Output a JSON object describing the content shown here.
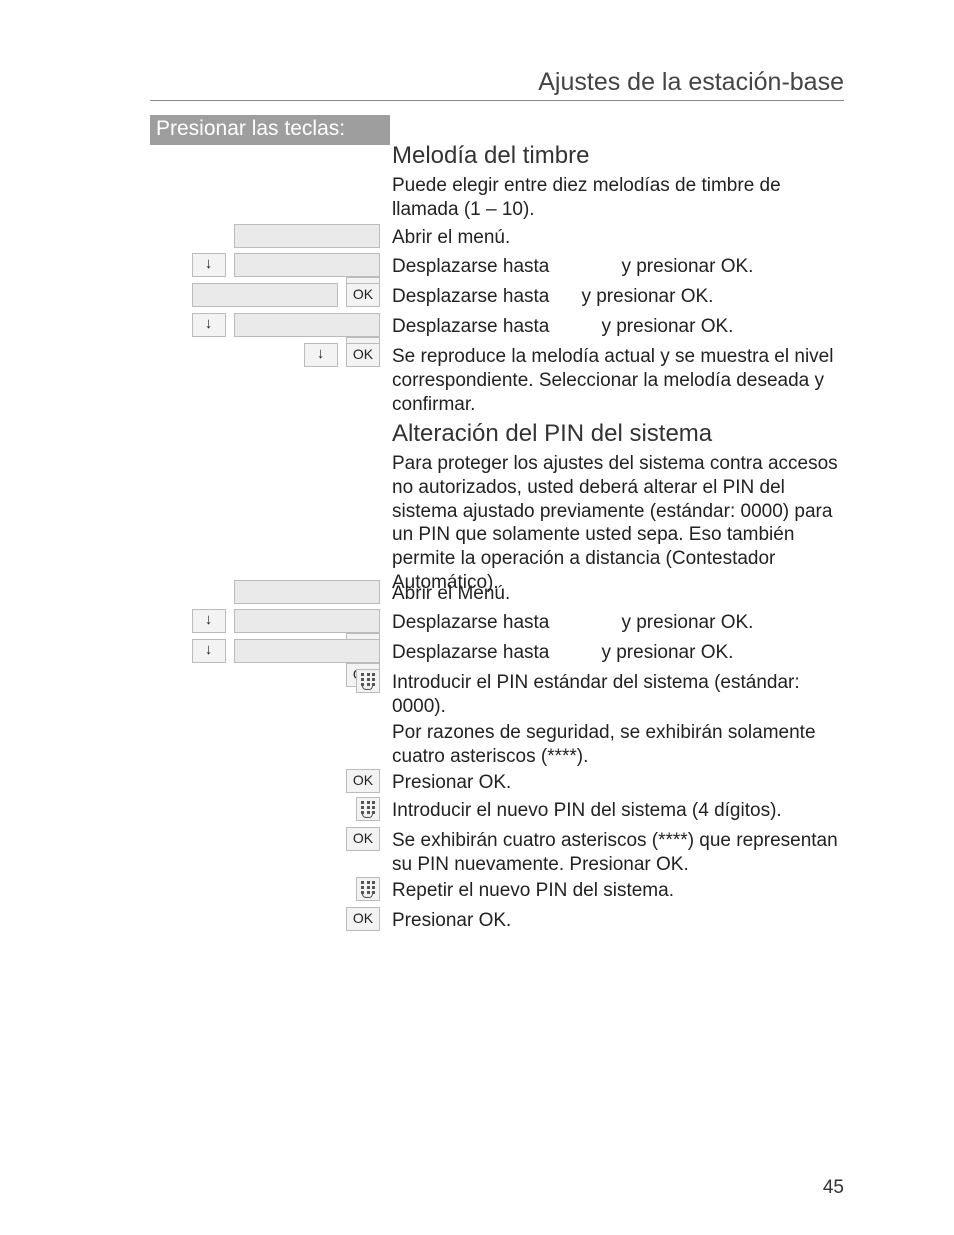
{
  "header": {
    "title": "Ajustes de la estación-base"
  },
  "sidebar": {
    "head": "Presionar las teclas:"
  },
  "keys": {
    "down": "↓",
    "ok": "OK"
  },
  "s1": {
    "title": "Melodía del timbre",
    "intro": "Puede elegir entre diez melodías de timbre de llamada (1 – 10).",
    "r1": "Abrir el menú.",
    "r2a": "Desplazarse hasta",
    "r2b": "y presionar OK.",
    "r3a": "Desplazarse hasta",
    "r3b": "y presionar OK.",
    "r4a": "Desplazarse hasta",
    "r4b": "y presionar OK.",
    "r5": "Se reproduce la melodía actual y se muestra el nivel correspondiente. Seleccionar la melodía deseada y confirmar."
  },
  "s2": {
    "title": "Alteración del PIN del sistema",
    "intro": "Para proteger los ajustes del sistema contra accesos no autorizados, usted deberá alterar el PIN del sistema ajustado previamente (estándar: 0000) para un PIN que solamente usted sepa. Eso también permite la operación a distancia (Contestador Automático).",
    "r1": "Abrir el Menú.",
    "r2a": "Desplazarse hasta",
    "r2b": "y presionar OK.",
    "r3a": "Desplazarse hasta",
    "r3b": "y presionar OK.",
    "r4": "Introducir el PIN estándar del sistema (estándar: 0000).",
    "r5": "Por razones de seguridad, se exhibirán solamente cuatro asteriscos (****).",
    "r6": "Presionar OK.",
    "r7": "Introducir el nuevo PIN del sistema (4 dígitos).",
    "r8": "Se exhibirán cuatro asteriscos (****) que representan su PIN nuevamente. Presionar OK.",
    "r9": "Repetir el nuevo PIN del sistema.",
    "r10": "Presionar OK."
  },
  "page_number": "45"
}
